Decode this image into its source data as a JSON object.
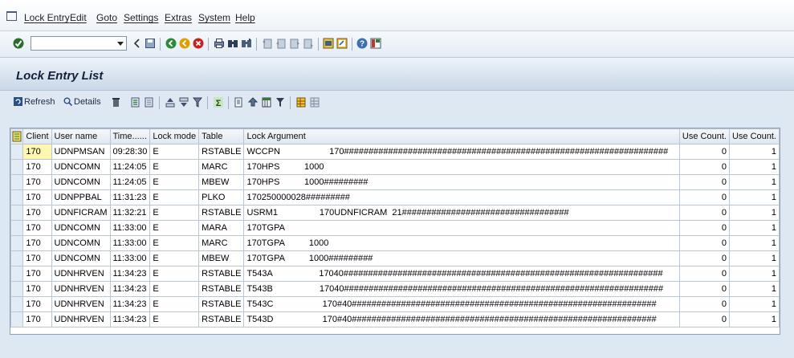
{
  "menu": [
    "Lock Entry",
    "Edit",
    "Goto",
    "Settings",
    "Extras",
    "System",
    "Help"
  ],
  "toolbar": {
    "icons": [
      "enter-icon",
      "back-icon",
      "save-icon",
      "back-nav-icon",
      "exit-icon",
      "cancel-icon",
      "print-icon",
      "find-icon",
      "find-next-icon",
      "first-page-icon",
      "prev-page-icon",
      "next-page-icon",
      "last-page-icon",
      "create-session-icon",
      "shortcut-icon",
      "help-icon",
      "layout-icon"
    ],
    "command_value": ""
  },
  "title": "Lock Entry List",
  "app_toolbar": {
    "refresh": "Refresh",
    "details": "Details"
  },
  "columns": [
    "Client",
    "User name",
    "Time......",
    "Lock mode",
    "Table",
    "Lock Argument",
    "Use Count.",
    "Use Count."
  ],
  "rows": [
    {
      "client": "170",
      "user": "UDNPMSAN",
      "time": "09:28:30",
      "mode": "E",
      "table": "RSTABLE",
      "arg": "WCCPN                    170##################################################################",
      "c1": "0",
      "c2": "1"
    },
    {
      "client": "170",
      "user": "UDNCOMN",
      "time": "11:24:05",
      "mode": "E",
      "table": "MARC",
      "arg": "170HPS          1000",
      "c1": "0",
      "c2": "1"
    },
    {
      "client": "170",
      "user": "UDNCOMN",
      "time": "11:24:05",
      "mode": "E",
      "table": "MBEW",
      "arg": "170HPS          1000#########",
      "c1": "0",
      "c2": "1"
    },
    {
      "client": "170",
      "user": "UDNPPBAL",
      "time": "11:31:23",
      "mode": "E",
      "table": "PLKO",
      "arg": "170250000028#########",
      "c1": "0",
      "c2": "1"
    },
    {
      "client": "170",
      "user": "UDNFICRAM",
      "time": "11:32:21",
      "mode": "E",
      "table": "RSTABLE",
      "arg": "USRM1                 170UDNFICRAM  21##################################",
      "c1": "0",
      "c2": "1"
    },
    {
      "client": "170",
      "user": "UDNCOMN",
      "time": "11:33:00",
      "mode": "E",
      "table": "MARA",
      "arg": "170TGPA",
      "c1": "0",
      "c2": "1"
    },
    {
      "client": "170",
      "user": "UDNCOMN",
      "time": "11:33:00",
      "mode": "E",
      "table": "MARC",
      "arg": "170TGPA          1000",
      "c1": "0",
      "c2": "1"
    },
    {
      "client": "170",
      "user": "UDNCOMN",
      "time": "11:33:00",
      "mode": "E",
      "table": "MBEW",
      "arg": "170TGPA          1000#########",
      "c1": "0",
      "c2": "1"
    },
    {
      "client": "170",
      "user": "UDNHRVEN",
      "time": "11:34:23",
      "mode": "E",
      "table": "RSTABLE",
      "arg": "T543A                   17040#################################################################",
      "c1": "0",
      "c2": "1"
    },
    {
      "client": "170",
      "user": "UDNHRVEN",
      "time": "11:34:23",
      "mode": "E",
      "table": "RSTABLE",
      "arg": "T543B                   17040#################################################################",
      "c1": "0",
      "c2": "1"
    },
    {
      "client": "170",
      "user": "UDNHRVEN",
      "time": "11:34:23",
      "mode": "E",
      "table": "RSTABLE",
      "arg": "T543C                    170#40##############################################################",
      "c1": "0",
      "c2": "1"
    },
    {
      "client": "170",
      "user": "UDNHRVEN",
      "time": "11:34:23",
      "mode": "E",
      "table": "RSTABLE",
      "arg": "T543D                    170#40##############################################################",
      "c1": "0",
      "c2": "1"
    }
  ]
}
